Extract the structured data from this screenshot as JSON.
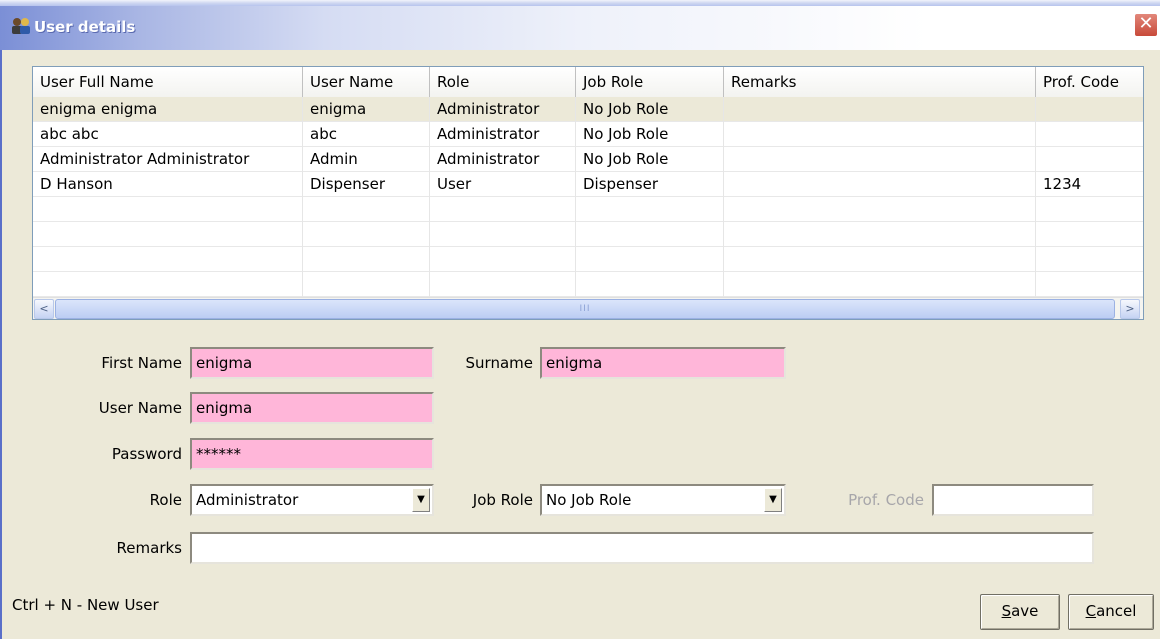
{
  "window": {
    "title": "User details",
    "close_symbol": "✕"
  },
  "grid": {
    "columns": [
      "User Full Name",
      "User Name",
      "Role",
      "Job Role",
      "Remarks",
      "Prof. Code"
    ],
    "rows": [
      [
        "enigma enigma",
        "enigma",
        "Administrator",
        "No Job Role",
        "",
        ""
      ],
      [
        "abc abc",
        "abc",
        "Administrator",
        "No Job Role",
        "",
        ""
      ],
      [
        "Administrator Administrator",
        "Admin",
        "Administrator",
        "No Job Role",
        "",
        ""
      ],
      [
        "D Hanson",
        "Dispenser",
        "User",
        "Dispenser",
        "",
        "1234"
      ]
    ],
    "selected_row": 0,
    "scroll_left_glyph": "<",
    "scroll_right_glyph": ">",
    "thumb_grip": "III"
  },
  "form": {
    "first_name_label": "First Name",
    "first_name_value": "enigma",
    "surname_label": "Surname",
    "surname_value": "enigma",
    "user_name_label": "User Name",
    "user_name_value": "enigma",
    "password_label": "Password",
    "password_value": "******",
    "role_label": "Role",
    "role_value": "Administrator",
    "job_role_label": "Job Role",
    "job_role_value": "No Job Role",
    "prof_code_label": "Prof. Code",
    "prof_code_value": "",
    "remarks_label": "Remarks",
    "remarks_value": "",
    "dropdown_arrow": "▼"
  },
  "status": {
    "hint": "Ctrl + N - New User"
  },
  "buttons": {
    "save_mnemonic": "S",
    "save_rest": "ave",
    "cancel_mnemonic": "C",
    "cancel_rest": "ancel"
  },
  "colors": {
    "required_field": "#ffb6d9",
    "window_bg": "#ece9d8",
    "selected_row": "#ece9d8",
    "close_button": "#c84a3a"
  },
  "icons": {
    "app_icon": "users-icon",
    "close_icon": "close-icon"
  }
}
